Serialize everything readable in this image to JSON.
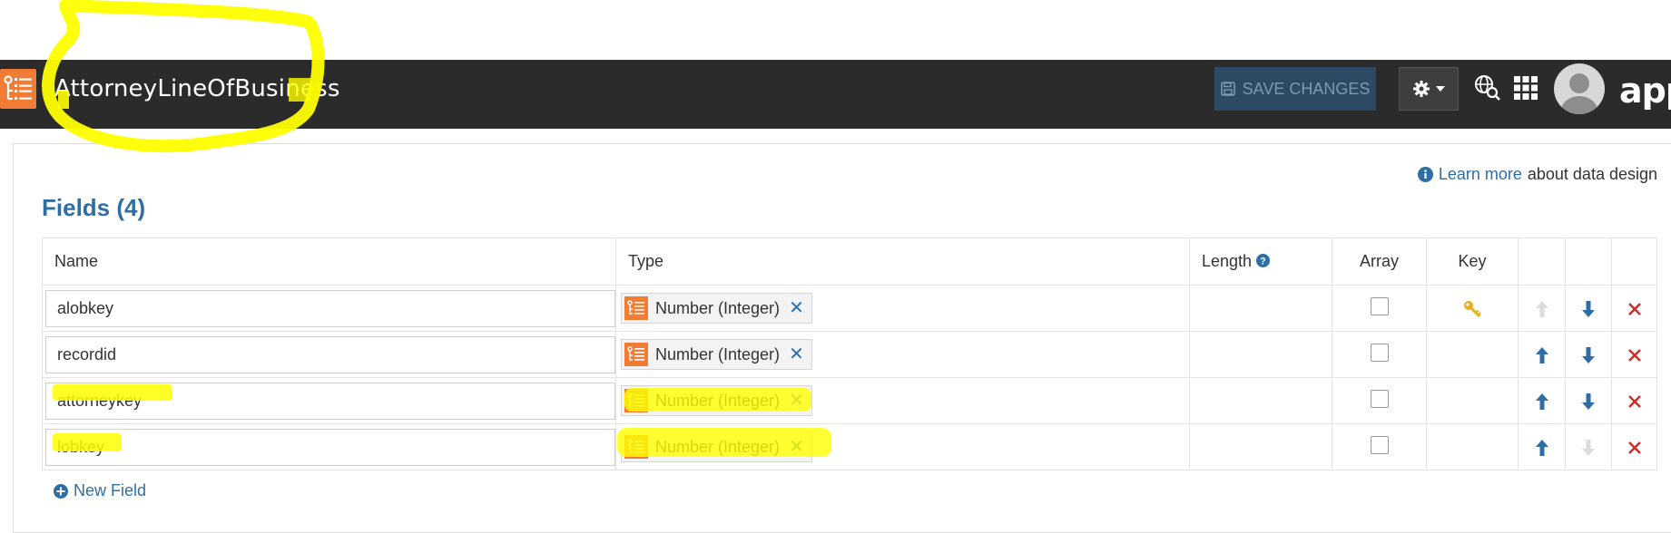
{
  "header": {
    "title": "AttorneyLineOfBusiness",
    "save_label": "SAVE CHANGES",
    "brand": "app"
  },
  "info": {
    "learn_link": "Learn more",
    "learn_suffix": "about data design"
  },
  "fields": {
    "title": "Fields (4)",
    "columns": {
      "name": "Name",
      "type": "Type",
      "length": "Length",
      "array": "Array",
      "key": "Key"
    },
    "rows": [
      {
        "name": "alobkey",
        "type": "Number (Integer)",
        "is_key": true,
        "can_move_up": false,
        "can_move_down": true
      },
      {
        "name": "recordid",
        "type": "Number (Integer)",
        "is_key": false,
        "can_move_up": true,
        "can_move_down": true
      },
      {
        "name": "attorneykey",
        "type": "Number (Integer)",
        "is_key": false,
        "can_move_up": true,
        "can_move_down": true
      },
      {
        "name": "lobkey",
        "type": "Number (Integer)",
        "is_key": false,
        "can_move_up": true,
        "can_move_down": false
      }
    ],
    "new_field_label": "New Field"
  },
  "colors": {
    "header_bg": "#2b2b2b",
    "accent_orange": "#f07c36",
    "link_blue": "#2f6ea5",
    "delete_red": "#c9302c",
    "key_gold": "#e8b01c",
    "highlight_yellow": "#ffff00"
  },
  "icons": [
    "app-logo-icon",
    "floppy-disk-icon",
    "gear-icon",
    "caret-down-icon",
    "globe-search-icon",
    "grid-apps-icon",
    "user-avatar-icon",
    "info-circle-icon",
    "help-circle-icon",
    "type-icon",
    "remove-x-icon",
    "key-icon",
    "arrow-up-icon",
    "arrow-down-icon",
    "delete-x-icon",
    "plus-circle-icon"
  ]
}
